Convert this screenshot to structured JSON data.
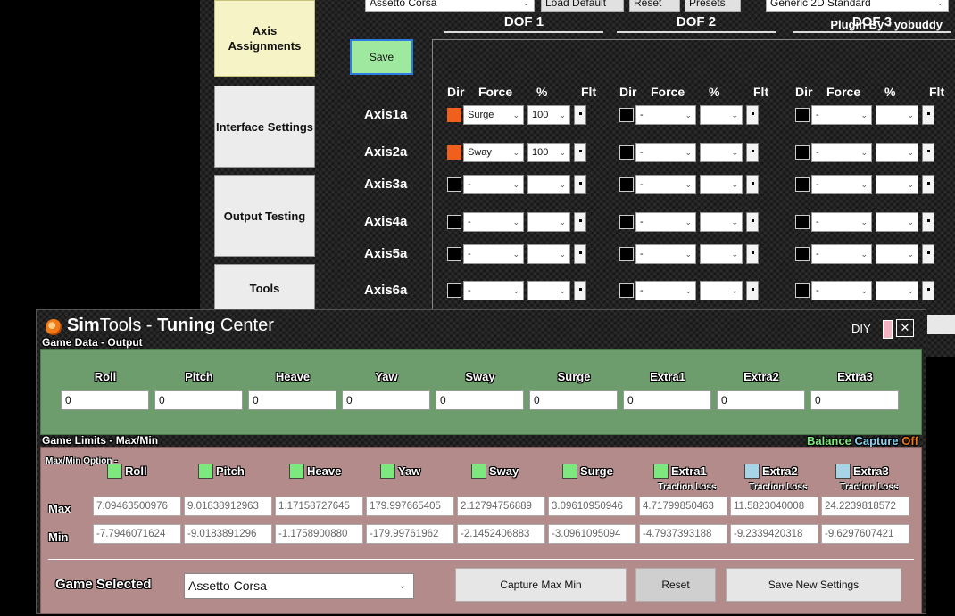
{
  "background_window": {
    "top_bar": {
      "game_value": "Assetto Corsa",
      "load_default_label": "Load Default",
      "reset_label": "Reset",
      "presets_label": "Presets",
      "interface_value": "Generic 2D Standard"
    },
    "plugin_credit": "Plugin By - yobuddy",
    "nav": {
      "axis_assignments": "Axis Assignments",
      "interface_settings": "Interface Settings",
      "output_testing": "Output Testing",
      "tools": "Tools"
    },
    "save_label": "Save",
    "dof_headers": [
      "DOF 1",
      "DOF 2",
      "DOF 3"
    ],
    "column_headers": {
      "dir": "Dir",
      "force": "Force",
      "percent": "%",
      "flt": "Flt"
    },
    "axes": [
      {
        "label": "Axis1a",
        "dof1": {
          "dir_on": true,
          "force": "Surge",
          "percent": "100"
        }
      },
      {
        "label": "Axis2a",
        "dof1": {
          "dir_on": true,
          "force": "Sway",
          "percent": "100"
        }
      },
      {
        "label": "Axis3a",
        "dof1": {
          "dir_on": false,
          "force": "-",
          "percent": ""
        }
      },
      {
        "label": "Axis4a",
        "dof1": {
          "dir_on": false,
          "force": "-",
          "percent": ""
        }
      },
      {
        "label": "Axis5a",
        "dof1": {
          "dir_on": false,
          "force": "-",
          "percent": ""
        }
      },
      {
        "label": "Axis6a",
        "dof1": {
          "dir_on": false,
          "force": "-",
          "percent": ""
        }
      }
    ],
    "empty_force": "-",
    "colors": {
      "dir_on": "#f0601c"
    }
  },
  "tuning_window": {
    "title": {
      "sim": "Sim",
      "tools": "Tools - ",
      "tuning": "Tuning",
      "center": " Center"
    },
    "diy_label": "DIY",
    "close_symbol": "✕",
    "game_data_label": "Game Data - Output",
    "outputs": [
      {
        "name": "Roll",
        "value": "0"
      },
      {
        "name": "Pitch",
        "value": "0"
      },
      {
        "name": "Heave",
        "value": "0"
      },
      {
        "name": "Yaw",
        "value": "0"
      },
      {
        "name": "Sway",
        "value": "0"
      },
      {
        "name": "Surge",
        "value": "0"
      },
      {
        "name": "Extra1",
        "value": "0"
      },
      {
        "name": "Extra2",
        "value": "0"
      },
      {
        "name": "Extra3",
        "value": "0"
      }
    ],
    "game_limits_label": "Game Limits - Max/Min",
    "balance": {
      "balance": "Balance",
      "capture": "Capture",
      "state": "Off"
    },
    "maxmin_option_label": "Max/Min Option -",
    "max_label": "Max",
    "min_label": "Min",
    "limits": [
      {
        "name": "Roll",
        "checkbox_color": "green",
        "sub": "",
        "max": "7.09463500976",
        "min": "-7.7946071624"
      },
      {
        "name": "Pitch",
        "checkbox_color": "green",
        "sub": "",
        "max": "9.01838912963",
        "min": "-9.0183891296"
      },
      {
        "name": "Heave",
        "checkbox_color": "green",
        "sub": "",
        "max": "1.17158727645",
        "min": "-1.1758900880"
      },
      {
        "name": "Yaw",
        "checkbox_color": "green",
        "sub": "",
        "max": "179.997665405",
        "min": "-179.99761962"
      },
      {
        "name": "Sway",
        "checkbox_color": "green",
        "sub": "",
        "max": "2.12794756889",
        "min": "-2.1452406883"
      },
      {
        "name": "Surge",
        "checkbox_color": "green",
        "sub": "",
        "max": "3.09610950946",
        "min": "-3.0961095094"
      },
      {
        "name": "Extra1",
        "checkbox_color": "green",
        "sub": "Traction Loss",
        "max": "4.71799850463",
        "min": "-4.7937393188"
      },
      {
        "name": "Extra2",
        "checkbox_color": "blue",
        "sub": "Traction Loss",
        "max": "11.5823040008",
        "min": "-9.2339420318"
      },
      {
        "name": "Extra3",
        "checkbox_color": "blue",
        "sub": "Traction Loss",
        "max": "24.2239818572",
        "min": "-9.6297607421"
      }
    ],
    "game_selected_label": "Game Selected",
    "game_selected_value": "Assetto Corsa",
    "capture_label": "Capture Max Min",
    "reset_label": "Reset",
    "save_settings_label": "Save New Settings",
    "colors": {
      "output_panel": "#6d9c6d",
      "limits_panel": "#b48b8b",
      "check_green": "#7de87d",
      "check_blue": "#a8d4e8",
      "balance": "#7de87d",
      "capture": "#8ad4f0",
      "off": "#f07a18"
    }
  }
}
